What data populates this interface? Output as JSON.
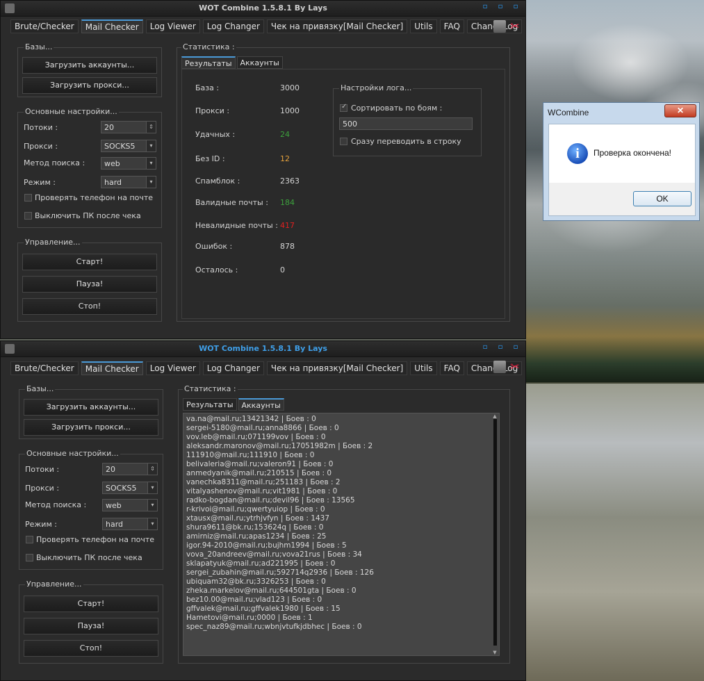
{
  "app": {
    "title": "WOT Combine 1.5.8.1 By Lays",
    "window_controls": [
      "▫",
      "▫",
      "▫"
    ]
  },
  "tabs": [
    "Brute/Checker",
    "Mail Checker",
    "Log  Viewer",
    "Log Changer",
    "Чек на привязку[Mail Checker]",
    "Utils",
    "FAQ",
    "ChangeLog"
  ],
  "active_tab": "Mail Checker",
  "bases": {
    "title": "Базы...",
    "load_accounts": "Загрузить аккаунты...",
    "load_proxy": "Загрузить прокси..."
  },
  "settings": {
    "title": "Основные настройки...",
    "threads_label": "Потоки :",
    "threads_value": "20",
    "proxy_label": "Прокси :",
    "proxy_value": "SOCKS5",
    "search_label": "Метод поиска :",
    "search_value": "web",
    "mode_label": "Режим  :",
    "mode_value": "hard",
    "check_phone": "Проверять телефон на почте",
    "shutdown": "Выключить ПК после чека"
  },
  "control": {
    "title": "Управление...",
    "start": "Старт!",
    "pause": "Пауза!",
    "stop": "Стоп!"
  },
  "stats": {
    "title": "Статистика :",
    "tab_results": "Результаты",
    "tab_accounts": "Аккаунты",
    "rows": [
      {
        "label": "База :",
        "value": "3000",
        "color": ""
      },
      {
        "label": "Прокси :",
        "value": "1000",
        "color": ""
      },
      {
        "label": "Удачных :",
        "value": "24",
        "color": "green"
      },
      {
        "label": "Без ID :",
        "value": "12",
        "color": "orange"
      },
      {
        "label": "Спамблок :",
        "value": "2363",
        "color": ""
      },
      {
        "label": "Валидные почты :",
        "value": "184",
        "color": "green"
      },
      {
        "label": "Невалидные почты :",
        "value": "417",
        "color": "red"
      },
      {
        "label": "Ошибок :",
        "value": "878",
        "color": ""
      },
      {
        "label": "Осталось :",
        "value": "0",
        "color": ""
      }
    ]
  },
  "log_settings": {
    "title": "Настройки лога...",
    "sort_label": "Сортировать по боям :",
    "sort_value": "500",
    "line_label": "Сразу переводить в строку"
  },
  "accounts": [
    "va.na@mail.ru;13421342 | Боев : 0",
    "sergei-5180@mail.ru;anna8866 | Боев : 0",
    "vov.leb@mail.ru;071199vov | Боев : 0",
    "aleksandr.maronov@mail.ru;17051982m | Боев : 2",
    "111910@mail.ru;111910 | Боев : 0",
    "belivaleria@mail.ru;valeron91 | Боев : 0",
    "anmedyanik@mail.ru;210515 | Боев : 0",
    "vanechka8311@mail.ru;251183 | Боев : 2",
    "vitalyashenov@mail.ru;vit1981 | Боев : 0",
    "radko-bogdan@mail.ru;devil96 | Боев : 13565",
    "r-krivoi@mail.ru;qwertyuiop | Боев : 0",
    "xtausx@mail.ru;ytrhjvfyn | Боев : 1437",
    "shura9611@bk.ru;153624q | Боев : 0",
    "amirniz@mail.ru;apas1234 | Боев : 25",
    "igor.94-2010@mail.ru;bujhm1994 | Боев : 5",
    "vova_20andreev@mail.ru;vova21rus | Боев : 34",
    "sklapatyuk@mail.ru;ad221995 | Боев : 0",
    "sergei_zubahin@mail.ru;592714q2936 | Боев : 126",
    "ubiquam32@bk.ru;3326253 | Боев : 0",
    "zheka.markelov@mail.ru;644501gta | Боев : 0",
    "bez10.00@mail.ru;vlad123 | Боев : 0",
    "gffvalek@mail.ru;gffvalek1980 | Боев : 15",
    "Hametovi@mail.ru;0000 | Боев : 1",
    "spec_naz89@mail.ru;wbnjvtufkjdbhec | Боев : 0"
  ],
  "dialog": {
    "title": "WCombine",
    "message": "Проверка окончена!",
    "ok": "OK",
    "close": "✕"
  },
  "colors": {
    "green": "#3da13d",
    "orange": "#e6a23c",
    "red": "#e02020",
    "accent": "#4a9ad8"
  }
}
